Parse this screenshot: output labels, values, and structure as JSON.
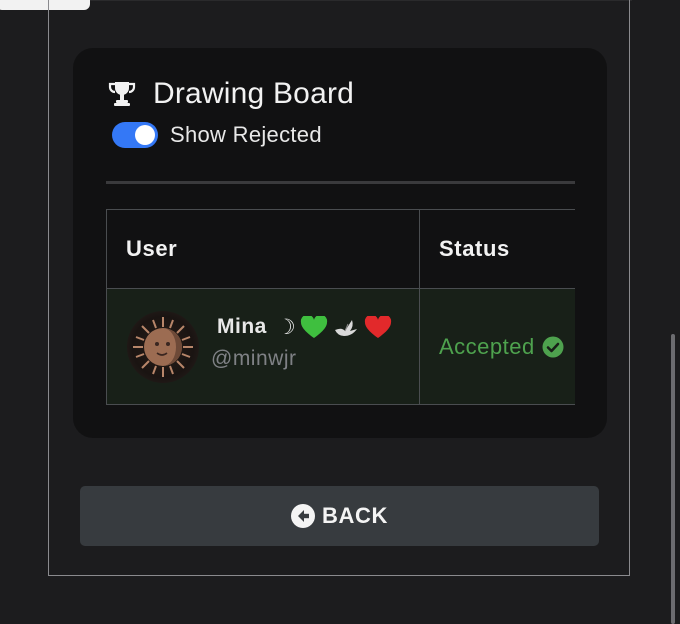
{
  "card": {
    "title": "Drawing Board",
    "title_icon": "trophy-icon"
  },
  "toggle": {
    "label": "Show Rejected",
    "checked": true,
    "color": "#3478f6"
  },
  "table": {
    "columns": [
      "User",
      "Status"
    ],
    "rows": [
      {
        "name": "Mina",
        "emojis": [
          "☽",
          "💚",
          "🕊️",
          "❤️"
        ],
        "handle": "@minwjr",
        "status": "Accepted",
        "status_icon": "check-circle-icon",
        "status_color": "#4ea24e"
      }
    ]
  },
  "back_button": {
    "label": "BACK",
    "icon": "arrow-left-circle-icon"
  }
}
